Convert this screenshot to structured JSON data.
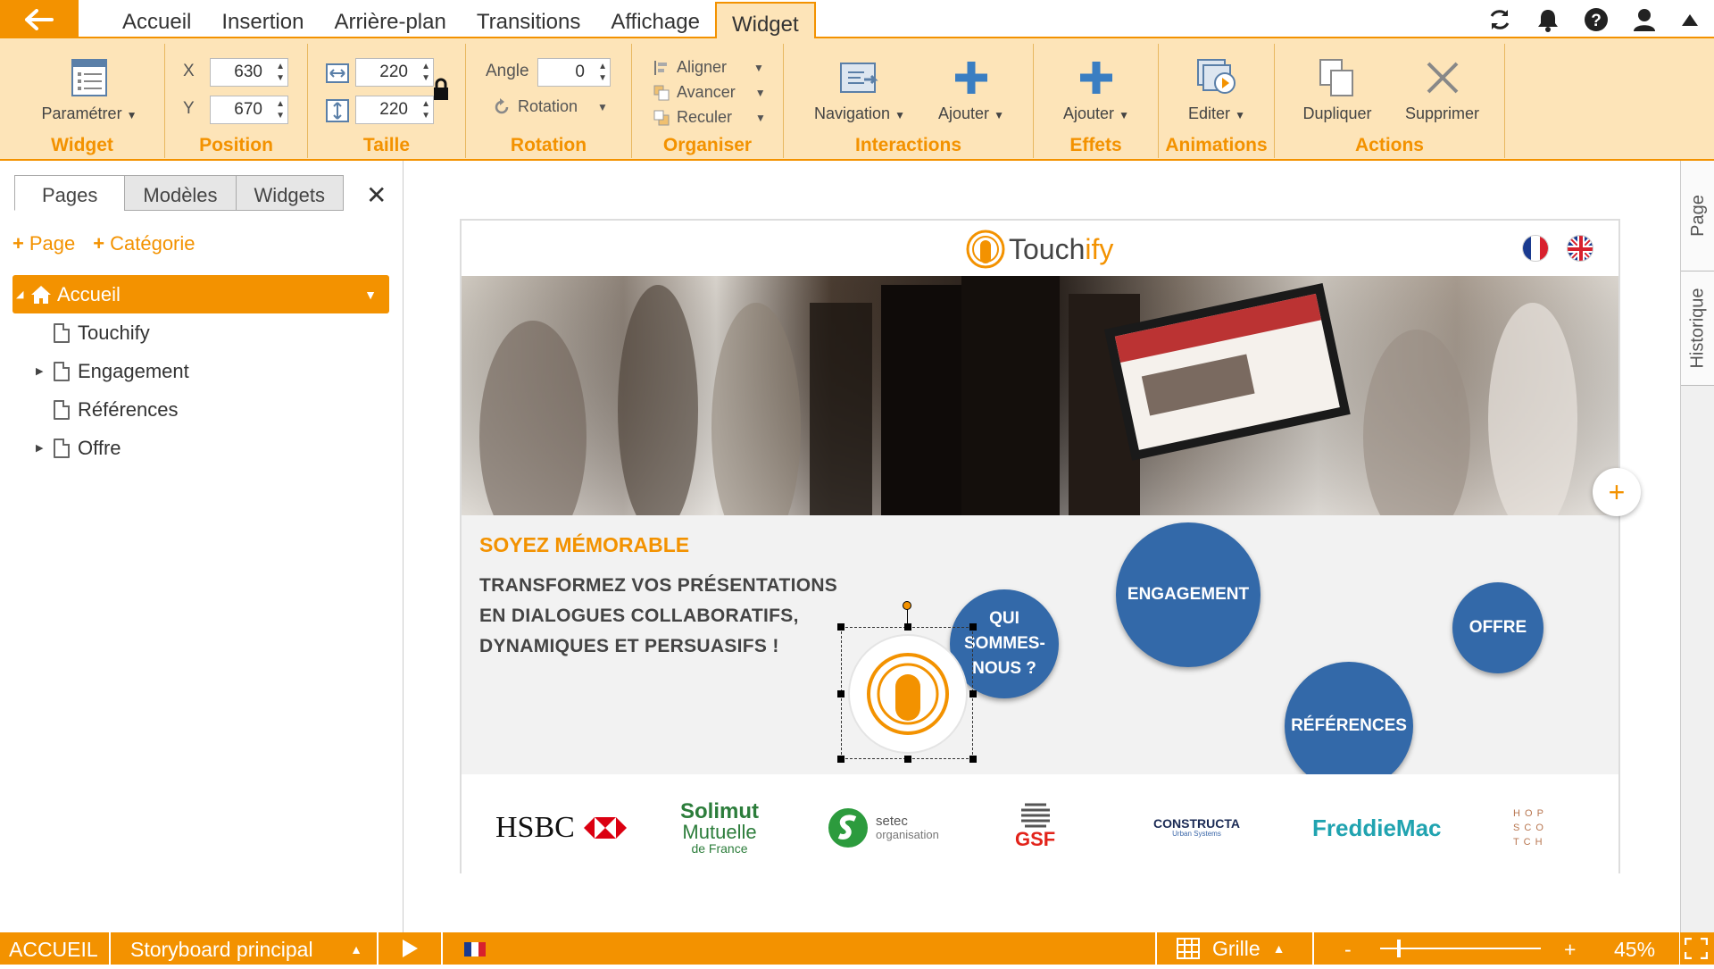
{
  "menubar": {
    "tabs": [
      "Accueil",
      "Insertion",
      "Arrière-plan",
      "Transitions",
      "Affichage",
      "Widget"
    ],
    "active_tab": "Widget"
  },
  "ribbon": {
    "widget": {
      "button": "Paramétrer",
      "label": "Widget"
    },
    "position": {
      "x_label": "X",
      "x_value": "630",
      "y_label": "Y",
      "y_value": "670",
      "label": "Position"
    },
    "taille": {
      "w_value": "220",
      "h_value": "220",
      "label": "Taille"
    },
    "rotation": {
      "angle_label": "Angle",
      "angle_value": "0",
      "rotation_button": "Rotation",
      "label": "Rotation"
    },
    "organiser": {
      "aligner": "Aligner",
      "avancer": "Avancer",
      "reculer": "Reculer",
      "label": "Organiser"
    },
    "interactions": {
      "navigation": "Navigation",
      "ajouter": "Ajouter",
      "label": "Interactions"
    },
    "effets": {
      "ajouter": "Ajouter",
      "label": "Effets"
    },
    "animations": {
      "editer": "Editer",
      "label": "Animations"
    },
    "actions": {
      "dupliquer": "Dupliquer",
      "supprimer": "Supprimer",
      "label": "Actions"
    }
  },
  "leftpanel": {
    "tabs": [
      "Pages",
      "Modèles",
      "Widgets"
    ],
    "active_tab": "Pages",
    "add_page": "Page",
    "add_category": "Catégorie",
    "tree": [
      {
        "label": "Accueil",
        "level": 0,
        "active": true,
        "expanded": true
      },
      {
        "label": "Touchify",
        "level": 1,
        "has_children": false
      },
      {
        "label": "Engagement",
        "level": 1,
        "has_children": true
      },
      {
        "label": "Références",
        "level": 1,
        "has_children": false
      },
      {
        "label": "Offre",
        "level": 1,
        "has_children": true
      }
    ]
  },
  "slide": {
    "brand_prefix": "Touch",
    "brand_suffix": "ify",
    "title": "SOYEZ MÉMORABLE",
    "text": "TRANSFORMEZ VOS PRÉSENTATIONS EN DIALOGUES COLLABORATIFS, DYNAMIQUES ET PERSUASIFS !",
    "bubbles": {
      "qui": "QUI SOMMES-NOUS ?",
      "engagement": "ENGAGEMENT",
      "references": "RÉFÉRENCES",
      "offre": "OFFRE"
    },
    "logos": {
      "hsbc": "HSBC",
      "solimut": "Solimut",
      "mutuelle": "Mutuelle",
      "de_france": "de France",
      "setec": "setec",
      "organisation": "organisation",
      "gsf": "GSF",
      "constructa": "CONSTRUCTA",
      "urban": "Urban Systems",
      "freddie": "FreddieMac",
      "hopscotch": "H O P\nS C O\nT C H"
    }
  },
  "rightbar": {
    "tabs": [
      "Page",
      "Historique"
    ]
  },
  "statusbar": {
    "page": "ACCUEIL",
    "storyboard": "Storyboard principal",
    "grid": "Grille",
    "zoom_minus": "-",
    "zoom_plus": "+",
    "zoom": "45%"
  },
  "colors": {
    "accent": "#f39200",
    "ribbon_bg": "#fde4b8",
    "bubble_blue": "#3369a9"
  }
}
